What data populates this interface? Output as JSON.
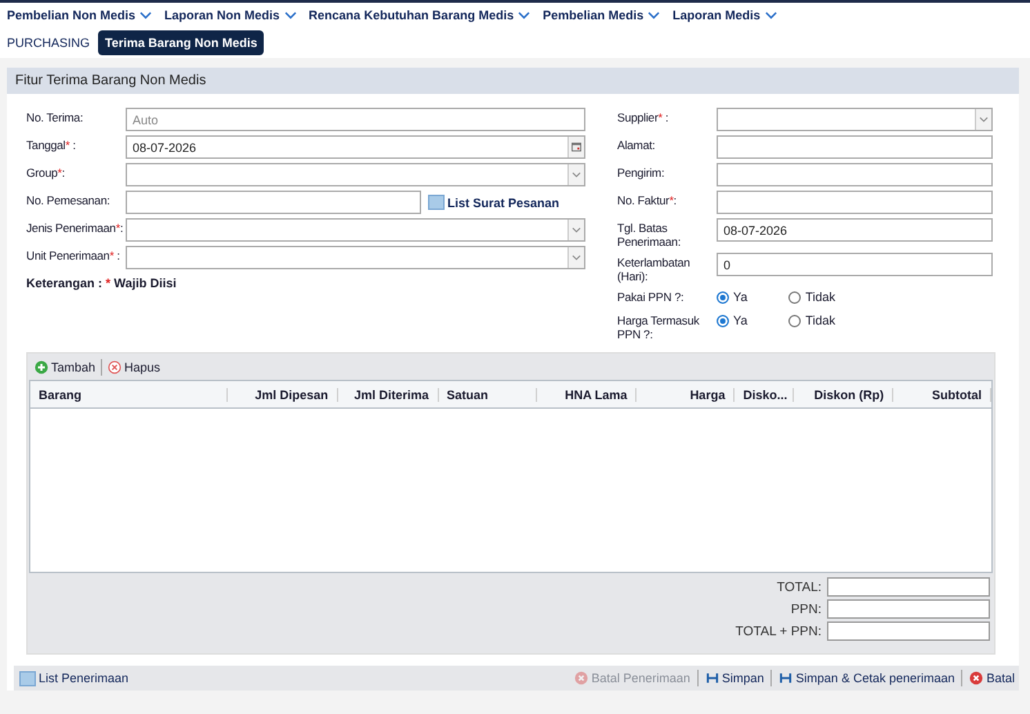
{
  "menu": [
    {
      "label": "Pembelian Non Medis"
    },
    {
      "label": "Laporan Non Medis"
    },
    {
      "label": "Rencana Kebutuhan Barang Medis"
    },
    {
      "label": "Pembelian Medis"
    },
    {
      "label": "Laporan Medis"
    }
  ],
  "breadcrumb": {
    "section": "PURCHASING",
    "tabs": [
      {
        "label": "Terima Barang Non Medis",
        "selected": true
      }
    ]
  },
  "panel_title": "Fitur Terima Barang Non Medis",
  "left_fields": [
    {
      "kind": "text",
      "label": "No. Terima:",
      "placeholder": "Auto"
    },
    {
      "kind": "date",
      "label": "Tanggal",
      "star": "*",
      "tail": " :",
      "value": "08-07-2026"
    },
    {
      "kind": "select",
      "label": "Group",
      "star": "*",
      "tail": ":"
    },
    {
      "kind": "lookup",
      "label": "No. Pemesanan:",
      "link": "List Surat Pesanan"
    },
    {
      "kind": "select",
      "label": "Jenis Penerimaan",
      "star": "*",
      "tail": ":"
    },
    {
      "kind": "select",
      "label": "Unit Penerimaan",
      "star": "*",
      "tail": " :"
    }
  ],
  "note": {
    "label": "Keterangan :",
    "star": "*",
    "text": "Wajib Diisi"
  },
  "right_fields": [
    {
      "kind": "select",
      "label": "Supplier",
      "star": "*",
      "tail": " :"
    },
    {
      "kind": "text",
      "label": "Alamat:"
    },
    {
      "kind": "text",
      "label": "Pengirim:"
    },
    {
      "kind": "text",
      "label": "No. Faktur",
      "star": "*",
      "tail": ":"
    },
    {
      "kind": "text",
      "label": "Tgl. Batas Penerimaan:",
      "value": "08-07-2026"
    },
    {
      "kind": "text",
      "label": "Keterlambatan (Hari):",
      "value": "0"
    },
    {
      "kind": "radio",
      "label": "Pakai PPN ?:",
      "options": [
        {
          "label": "Ya",
          "selected": true
        },
        {
          "label": "Tidak",
          "selected": false
        }
      ]
    },
    {
      "kind": "radio",
      "label": "Harga Termasuk PPN ?:",
      "options": [
        {
          "label": "Ya",
          "selected": true
        },
        {
          "label": "Tidak",
          "selected": false
        }
      ]
    }
  ],
  "grid": {
    "toolbar": [
      {
        "kind": "add",
        "label": "Tambah"
      },
      {
        "kind": "delete",
        "label": "Hapus"
      }
    ],
    "columns": [
      {
        "label": "Barang"
      },
      {
        "label": "Jml Dipesan"
      },
      {
        "label": "Jml Diterima"
      },
      {
        "label": "Satuan"
      },
      {
        "label": "HNA Lama"
      },
      {
        "label": "Harga"
      },
      {
        "label": "Disko..."
      },
      {
        "label": "Diskon (Rp)"
      },
      {
        "label": "Subtotal"
      }
    ]
  },
  "totals": [
    {
      "label": "TOTAL:"
    },
    {
      "label": "PPN:"
    },
    {
      "label": "TOTAL + PPN:"
    }
  ],
  "footer": {
    "left": {
      "label": "List Penerimaan"
    },
    "buttons": [
      {
        "kind": "cancel",
        "label": "Batal Penerimaan",
        "disabled": true
      },
      {
        "kind": "save",
        "label": "Simpan",
        "disabled": false
      },
      {
        "kind": "save",
        "label": "Simpan & Cetak penerimaan",
        "disabled": false
      },
      {
        "kind": "cancel",
        "label": "Batal",
        "disabled": false
      }
    ]
  }
}
